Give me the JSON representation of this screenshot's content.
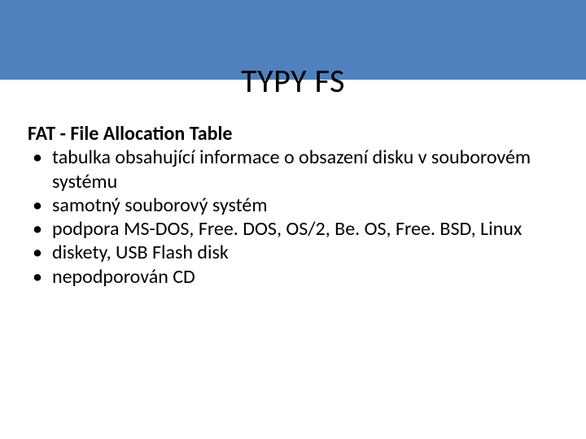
{
  "title": "TYPY FS",
  "subtitle": "FAT - File Allocation Table",
  "bullets": [
    "tabulka obsahující informace o obsazení disku v souborovém systému",
    "samotný souborový systém",
    "podpora MS-DOS, Free. DOS, OS/2, Be. OS, Free. BSD, Linux",
    "diskety, USB Flash disk",
    "nepodporován  CD"
  ]
}
